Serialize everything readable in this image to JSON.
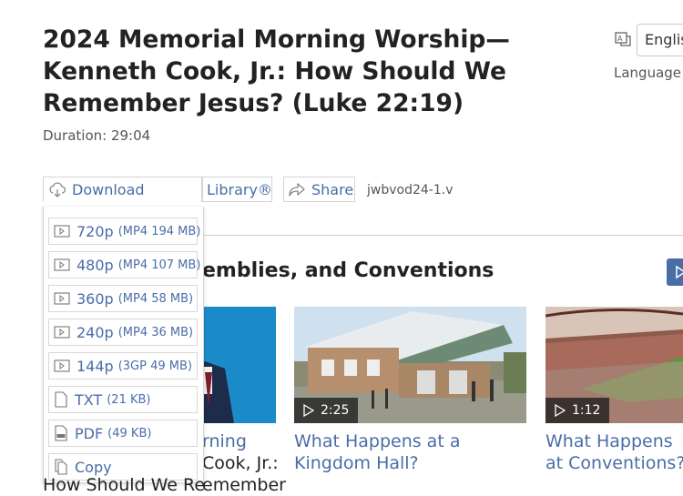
{
  "header": {
    "title": "2024 Memorial Morning Worship—Kenneth Cook, Jr.: How Should We Remember Jesus? (Luke 22:19)",
    "duration": "Duration: 29:04"
  },
  "language": {
    "selected": "Englis",
    "label": "Language"
  },
  "actions": {
    "download_label": "Download",
    "library_label": "Library®",
    "share_label": "Share",
    "file_label": "jwbvod24-1.v"
  },
  "download_menu": {
    "items": [
      {
        "label": "720p",
        "size": "(MP4 194 MB)"
      },
      {
        "label": "480p",
        "size": "(MP4 107 MB)"
      },
      {
        "label": "360p",
        "size": "(MP4 58 MB)"
      },
      {
        "label": "240p",
        "size": "(MP4 36 MB)"
      },
      {
        "label": "144p",
        "size": "(3GP 49 MB)"
      },
      {
        "label": "TXT",
        "size": "(21 KB)"
      },
      {
        "label": "PDF",
        "size": "(49 KB)"
      },
      {
        "label": "Copy",
        "size": ""
      }
    ]
  },
  "section": {
    "title": "emblies, and Conventions"
  },
  "videos": [
    {
      "title_line1": "rning",
      "title_line2": "Cook, Jr.:",
      "title_line3": "emember",
      "title_line4": "How Should We Re"
    },
    {
      "duration": "2:25",
      "title": "What Happens at a Kingdom Hall?"
    },
    {
      "duration": "1:12",
      "title": "What Happens at Conventions?"
    }
  ],
  "colors": {
    "link": "#4a6da7",
    "accent_button": "#4a6da7",
    "thumb1_bg": "#1a8ac8"
  }
}
